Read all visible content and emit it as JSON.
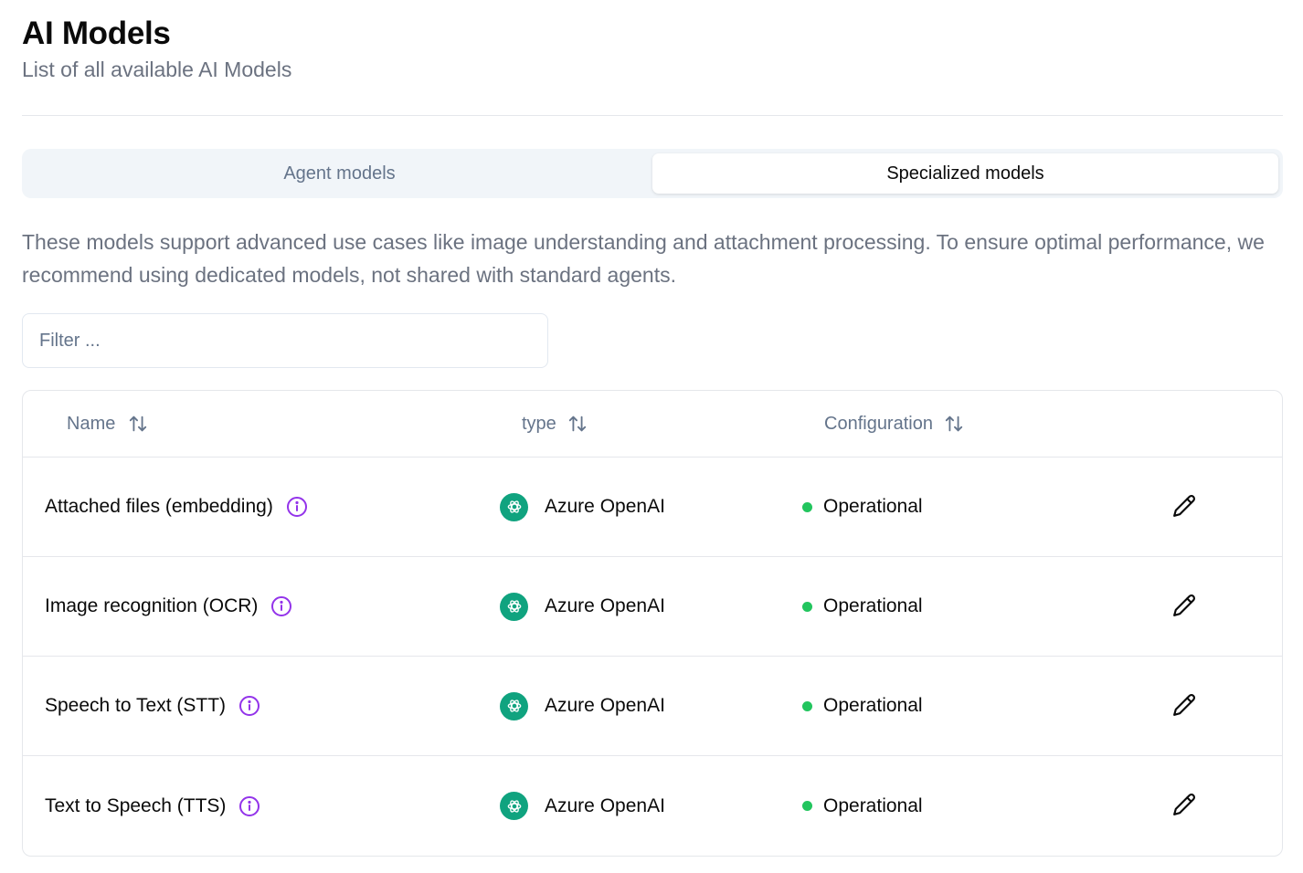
{
  "header": {
    "title": "AI Models",
    "subtitle": "List of all available AI Models"
  },
  "tabs": [
    {
      "label": "Agent models",
      "active": false
    },
    {
      "label": "Specialized models",
      "active": true
    }
  ],
  "description": "These models support advanced use cases like image understanding and attachment processing. To ensure optimal performance, we recommend using dedicated models, not shared with standard agents.",
  "filter": {
    "placeholder": "Filter ...",
    "value": ""
  },
  "table": {
    "columns": [
      {
        "label": "Name",
        "sort_icon": "sort-arrows-icon"
      },
      {
        "label": "type",
        "sort_icon": "sort-arrows-icon"
      },
      {
        "label": "Configuration",
        "sort_icon": "sort-arrows-icon"
      }
    ],
    "rows": [
      {
        "name": "Attached files (embedding)",
        "type": "Azure OpenAI",
        "status": "Operational"
      },
      {
        "name": "Image recognition (OCR)",
        "type": "Azure OpenAI",
        "status": "Operational"
      },
      {
        "name": "Speech to Text (STT)",
        "type": "Azure OpenAI",
        "status": "Operational"
      },
      {
        "name": "Text to Speech (TTS)",
        "type": "Azure OpenAI",
        "status": "Operational"
      }
    ]
  },
  "colors": {
    "info_icon": "#9333ea",
    "status_operational": "#22c55e",
    "provider_logo_bg": "#10a37f"
  },
  "icons": {
    "info": "info-circle-icon",
    "provider": "openai-logo-icon",
    "edit": "pencil-icon"
  }
}
